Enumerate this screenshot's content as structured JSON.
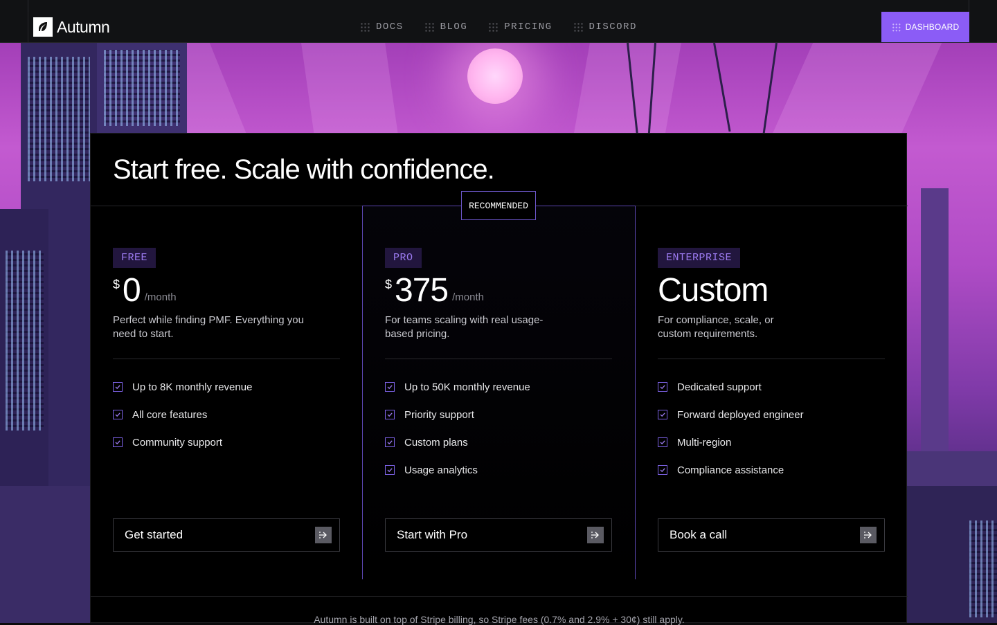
{
  "brand": {
    "name": "Autumn"
  },
  "nav": {
    "links": [
      {
        "label": "DOCS"
      },
      {
        "label": "BLOG"
      },
      {
        "label": "PRICING"
      },
      {
        "label": "DISCORD"
      }
    ],
    "dashboard_label": "DASHBOARD"
  },
  "pricing": {
    "headline": "Start free. Scale with confidence.",
    "recommended_label": "RECOMMENDED",
    "plans": [
      {
        "tier": "FREE",
        "currency": "$",
        "amount": "0",
        "period": "/month",
        "description": "Perfect while finding PMF. Everything you need to start.",
        "features": [
          "Up to 8K monthly revenue",
          "All core features",
          "Community support"
        ],
        "cta": "Get started"
      },
      {
        "tier": "PRO",
        "currency": "$",
        "amount": "375",
        "period": "/month",
        "description": "For teams scaling with real usage-based pricing.",
        "features": [
          "Up to 50K monthly revenue",
          "Priority support",
          "Custom plans",
          "Usage analytics"
        ],
        "cta": "Start with Pro"
      },
      {
        "tier": "ENTERPRISE",
        "amount": "Custom",
        "description": "For compliance, scale, or custom requirements.",
        "features": [
          "Dedicated support",
          "Forward deployed engineer",
          "Multi-region",
          "Compliance assistance"
        ],
        "cta": "Book a call"
      }
    ],
    "footnote": "Autumn is built on top of Stripe billing, so Stripe fees (0.7% and 2.9% + 30¢) still apply."
  },
  "colors": {
    "accent": "#8b5cf6",
    "tier_bg": "#22163e",
    "tier_text": "#9d7cf2",
    "panel_bg": "#000000"
  }
}
